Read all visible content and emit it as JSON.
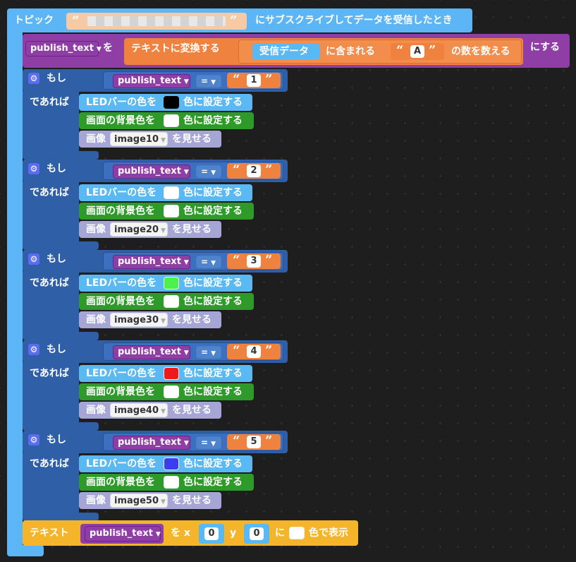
{
  "subscribe": {
    "label": "トピック",
    "topic_placeholder": "",
    "suffix": "にサブスクライブしてデータを受信したとき"
  },
  "set_var": {
    "var": "publish_text",
    "wo": "を",
    "convert": "テキストに変換する",
    "received": "受信データ",
    "contained": "に含まれる",
    "char": "A",
    "count": "の数を数える",
    "suru": "にする"
  },
  "if_labels": {
    "if": "もし",
    "then": "であれば",
    "eq": "="
  },
  "led_label_pre": "LEDバーの色を",
  "led_label_post": "色に設定する",
  "bg_label_pre": "画面の背景色を",
  "bg_label_post": "色に設定する",
  "img_label_pre": "画像",
  "img_label_post": "を見せる",
  "conditions": [
    {
      "var": "publish_text",
      "value": "1",
      "led_color": "#000000",
      "bg_color": "#ffffff",
      "image": "image10"
    },
    {
      "var": "publish_text",
      "value": "2",
      "led_color": "#ffffff",
      "bg_color": "#ffffff",
      "image": "image20"
    },
    {
      "var": "publish_text",
      "value": "3",
      "led_color": "#4cf24c",
      "bg_color": "#ffffff",
      "image": "image30"
    },
    {
      "var": "publish_text",
      "value": "4",
      "led_color": "#ee1a1a",
      "bg_color": "#ffffff",
      "image": "image40"
    },
    {
      "var": "publish_text",
      "value": "5",
      "led_color": "#3c3cf0",
      "bg_color": "#ffffff",
      "image": "image50"
    }
  ],
  "show_text": {
    "label": "テキスト",
    "var": "publish_text",
    "at_x": "を x",
    "x": "0",
    "y_label": "y",
    "y": "0",
    "ni": "に",
    "color": "#ffffff",
    "suffix": "色で表示"
  },
  "colors": {
    "subscribe": "#5cb6f5",
    "variable": "#8f3ea6",
    "text": "#f0823f",
    "if": "#2f5fa6",
    "led": "#5ab8f2",
    "background": "#2e9a2a",
    "image": "#a6a6d6",
    "show": "#f5b52a"
  }
}
